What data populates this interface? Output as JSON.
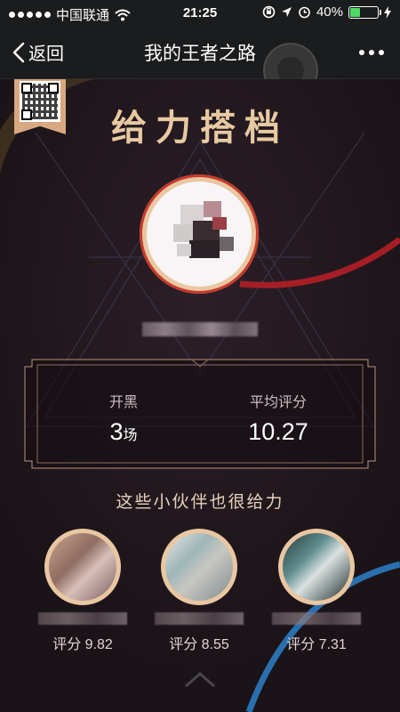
{
  "status_bar": {
    "carrier": "中国联通",
    "time": "21:25",
    "battery_text": "40%",
    "battery_level": 0.4,
    "icons": [
      "wifi-icon",
      "orientation-lock-icon",
      "location-icon",
      "alarm-icon",
      "charging-icon"
    ]
  },
  "nav": {
    "back_label": "返回",
    "title": "我的王者之路",
    "more_icon": "more-icon"
  },
  "page": {
    "title": "给力搭档"
  },
  "stats": {
    "games_label": "开黑",
    "games_value": "3",
    "games_unit": "场",
    "score_label": "平均评分",
    "score_value": "10.27"
  },
  "partners_section": {
    "title": "这些小伙伴也很给力",
    "partners": [
      {
        "score": "评分 9.82"
      },
      {
        "score": "评分 8.55"
      },
      {
        "score": "评分 7.31"
      }
    ]
  },
  "colors": {
    "accent_gold": "#e7c9a2",
    "background": "#1c1519",
    "arc_red": "#c0242a",
    "arc_blue": "#2e7bbf",
    "battery_green": "#4cd964"
  }
}
